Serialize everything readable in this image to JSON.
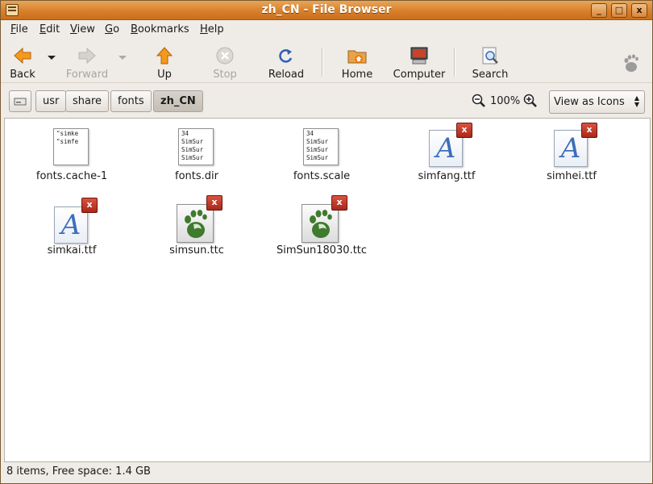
{
  "window": {
    "title": "zh_CN - File Browser",
    "controls": {
      "minimize": "_",
      "maximize": "□",
      "close": "x"
    }
  },
  "menubar": [
    {
      "label_prefix": "",
      "mnemonic": "F",
      "label_rest": "ile"
    },
    {
      "label_prefix": "",
      "mnemonic": "E",
      "label_rest": "dit"
    },
    {
      "label_prefix": "",
      "mnemonic": "V",
      "label_rest": "iew"
    },
    {
      "label_prefix": "",
      "mnemonic": "G",
      "label_rest": "o"
    },
    {
      "label_prefix": "",
      "mnemonic": "B",
      "label_rest": "ookmarks"
    },
    {
      "label_prefix": "",
      "mnemonic": "H",
      "label_rest": "elp"
    }
  ],
  "toolbar": {
    "back": "Back",
    "forward": "Forward",
    "up": "Up",
    "stop": "Stop",
    "reload": "Reload",
    "home": "Home",
    "computer": "Computer",
    "search": "Search"
  },
  "location": {
    "crumbs": [
      "usr",
      "share",
      "fonts",
      "zh_CN"
    ],
    "zoom": "100%",
    "view_mode": "View as Icons"
  },
  "files": [
    {
      "name": "fonts.cache-1",
      "preview": [
        "\"simke",
        "\"simfe"
      ],
      "type": "text"
    },
    {
      "name": "fonts.dir",
      "preview": [
        "34",
        "SimSur",
        "SimSur",
        "SimSur"
      ],
      "type": "text"
    },
    {
      "name": "fonts.scale",
      "preview": [
        "34",
        "SimSur",
        "SimSur",
        "SimSur"
      ],
      "type": "text"
    },
    {
      "name": "simfang.ttf",
      "type": "font",
      "glyph": "A",
      "badge": "x"
    },
    {
      "name": "simhei.ttf",
      "type": "font",
      "glyph": "A",
      "badge": "x"
    },
    {
      "name": "simkai.ttf",
      "type": "font",
      "glyph": "A",
      "badge": "x"
    },
    {
      "name": "simsun.ttc",
      "type": "ttc",
      "badge": "x"
    },
    {
      "name": "SimSun18030.ttc",
      "type": "ttc",
      "badge": "x"
    }
  ],
  "status": "8 items, Free space: 1.4 GB",
  "colors": {
    "titlebar": "#d97f2a",
    "content_bg": "#ffffff",
    "badge": "#b8321f",
    "font_glyph": "#3d6ebb"
  }
}
